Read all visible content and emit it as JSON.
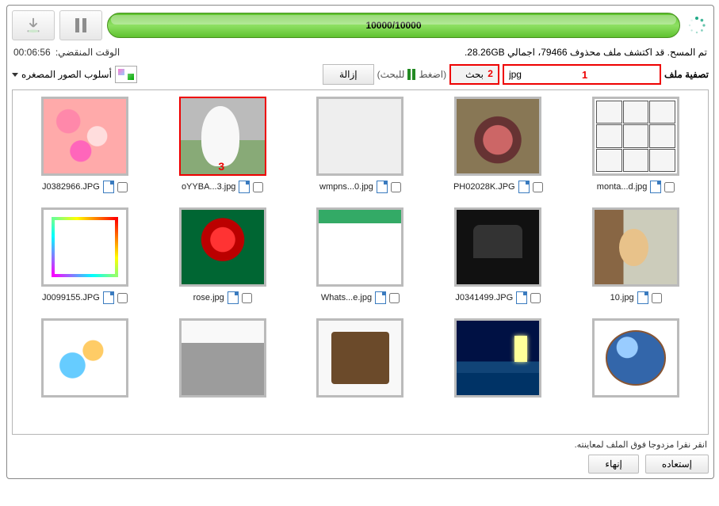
{
  "progress_text": "10000/10000",
  "elapsed_label": "الوقت المنقضي:",
  "elapsed_value": "00:06:56",
  "scan_result": "تم المسح. قد اكتشف ملف محذوف 79466، اجمالي 28.26GB.",
  "filter_label": "تصفية ملف",
  "filter_value": "jpg",
  "btn_search": "بحث",
  "hint_press": "(اضغط",
  "hint_press2": " للبحث)",
  "btn_remove": "إزالة",
  "style_label": "أسلوب الصور المصغره",
  "hint_bottom": "انقر نقرا مزدوجا فوق الملف لمعاينته.",
  "btn_restore": "إستعاده",
  "btn_finish": "إنهاء",
  "marker1": "1",
  "marker2": "2",
  "marker3": "3",
  "files": [
    {
      "name": "J0382966.JPG",
      "art": "ph-hearts"
    },
    {
      "name": "oYYBA...3.jpg",
      "art": "ph-cat",
      "sel": true
    },
    {
      "name": "wmpns...0.jpg",
      "art": "ph-media"
    },
    {
      "name": "PH02028K.JPG",
      "art": "ph-cup"
    },
    {
      "name": "monta...d.jpg",
      "art": "ph-montage"
    },
    {
      "name": "J0099155.JPG",
      "art": "ph-rainbow"
    },
    {
      "name": "rose.jpg",
      "art": "ph-rose"
    },
    {
      "name": "Whats...e.jpg",
      "art": "ph-whats"
    },
    {
      "name": "J0341499.JPG",
      "art": "ph-dark"
    },
    {
      "name": "10.jpg",
      "art": "ph-peek"
    },
    {
      "name": "",
      "art": "ph-baby",
      "nocap": true
    },
    {
      "name": "",
      "art": "ph-wed",
      "nocap": true
    },
    {
      "name": "",
      "art": "ph-suit",
      "nocap": true
    },
    {
      "name": "",
      "art": "ph-night",
      "nocap": true
    },
    {
      "name": "",
      "art": "ph-globe",
      "nocap": true
    }
  ]
}
